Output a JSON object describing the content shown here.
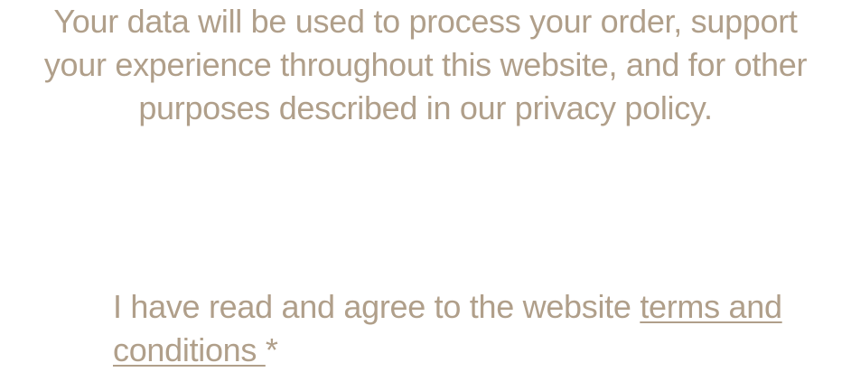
{
  "privacy_notice": {
    "lines": [
      "Your data will be used to process your order, support",
      "your experience throughout this website, and for other",
      "purposes described in our privacy policy."
    ]
  },
  "terms_checkbox": {
    "label_prefix": "I have read and agree to the website ",
    "link_text_line1": "terms and",
    "link_text_line2": "conditions ",
    "required_marker": "*"
  },
  "colors": {
    "text": "#b09f8a"
  }
}
